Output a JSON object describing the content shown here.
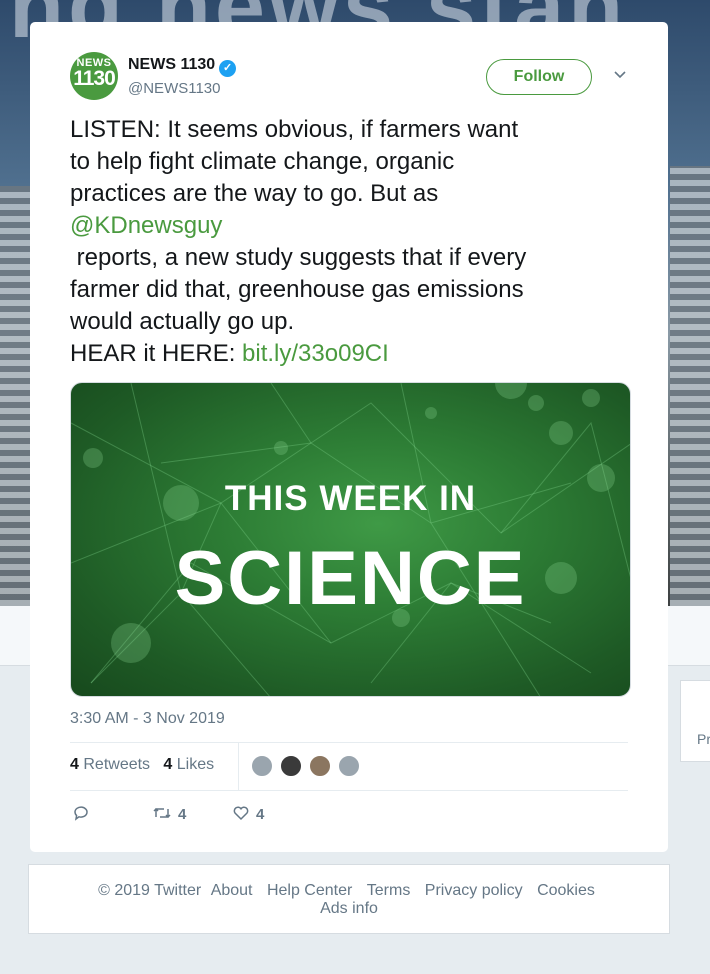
{
  "background": {
    "banner_text": "ing news stan",
    "side_label": "Pr"
  },
  "tweet": {
    "avatar_line1": "NEWS",
    "avatar_line2": "1130",
    "display_name": "NEWS 1130",
    "verified_mark": "✓",
    "handle": "@NEWS1130",
    "follow_label": "Follow",
    "text": {
      "line1": "LISTEN: It seems obvious, if farmers want",
      "line2": "to help fight climate change, organic",
      "line3": "practices are the way to go. But as",
      "mention": "@KDnewsguy",
      "line5": " reports, a new study suggests that if every",
      "line6": "farmer did that, greenhouse gas emissions",
      "line7": "would actually go up.",
      "line8_prefix": "HEAR it HERE: ",
      "url": "bit.ly/33o09CI"
    },
    "media": {
      "title_small": "THIS WEEK IN",
      "title_big": "SCIENCE"
    },
    "timestamp": "3:30 AM - 3 Nov 2019",
    "retweet_count": "4",
    "retweet_label": "Retweets",
    "like_count": "4",
    "like_label": "Likes",
    "actions": {
      "reply_count": "",
      "retweet_count": "4",
      "like_count": "4"
    }
  },
  "footer": {
    "copyright": "© 2019 Twitter",
    "links": [
      "About",
      "Help Center",
      "Terms",
      "Privacy policy",
      "Cookies",
      "Ads info"
    ]
  },
  "colors": {
    "accent": "#4a9a3f",
    "verified": "#1da1f2",
    "muted": "#657786"
  }
}
